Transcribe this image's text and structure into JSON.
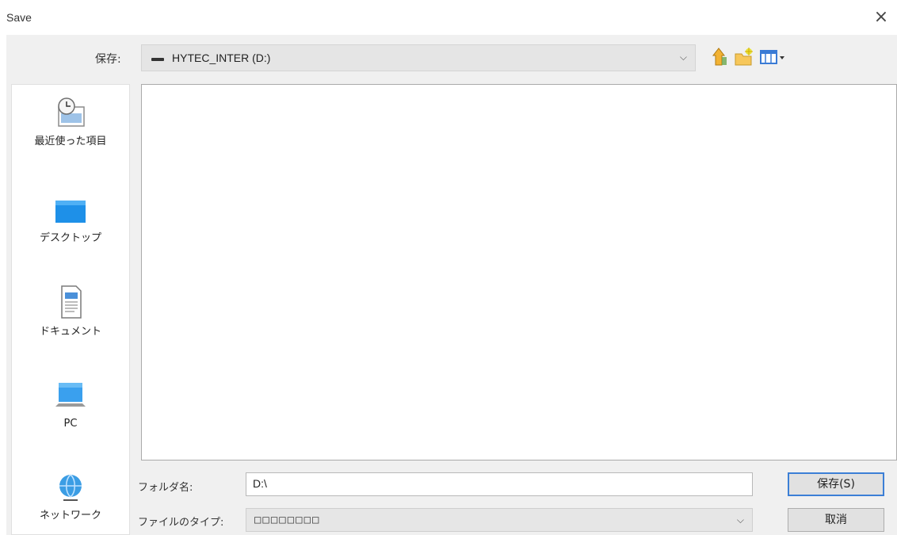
{
  "window": {
    "title": "Save",
    "close_glyph": "×"
  },
  "toolbar": {
    "look_in_label": "保存:",
    "look_in_value": "HYTEC_INTER (D:)",
    "combo_arrow": "⌵",
    "icons": [
      "drive-icon",
      "up-folder-icon",
      "new-folder-icon",
      "view-menu-icon"
    ]
  },
  "sidebar": {
    "items": [
      {
        "label": "最近使った項目",
        "icon": "recent-items-icon"
      },
      {
        "label": "デスクトップ",
        "icon": "desktop-icon"
      },
      {
        "label": "ドキュメント",
        "icon": "documents-icon"
      },
      {
        "label": "PC",
        "icon": "pc-icon"
      },
      {
        "label": "ネットワーク",
        "icon": "network-icon"
      }
    ]
  },
  "form": {
    "folder_name_label": "フォルダ名:",
    "folder_name_value": "D:\\",
    "file_type_label": "ファイルのタイプ:",
    "file_type_value": "□□□□□□□□",
    "file_type_arrow": "⌵"
  },
  "buttons": {
    "save": "保存(S)",
    "cancel": "取消"
  },
  "colors": {
    "dialog_bg": "#f0f0f0",
    "default_button_border": "#3c7fd6",
    "list_bg": "#ffffff"
  }
}
